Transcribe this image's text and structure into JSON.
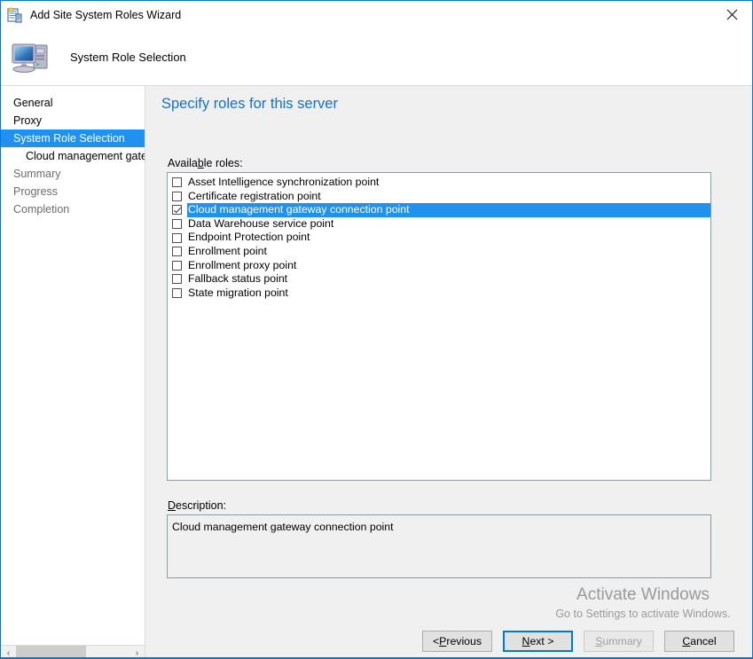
{
  "window": {
    "title": "Add Site System Roles Wizard",
    "icon": "wizard-document-icon",
    "close_label": "✕",
    "accent_color": "#0078d7"
  },
  "header": {
    "title": "System Role Selection",
    "icon": "computer-icon"
  },
  "sidebar": {
    "items": [
      {
        "label": "General",
        "state": "normal",
        "sub": false
      },
      {
        "label": "Proxy",
        "state": "normal",
        "sub": false
      },
      {
        "label": "System Role Selection",
        "state": "selected",
        "sub": false
      },
      {
        "label": "Cloud management gate",
        "state": "normal",
        "sub": true
      },
      {
        "label": "Summary",
        "state": "dim",
        "sub": false
      },
      {
        "label": "Progress",
        "state": "dim",
        "sub": false
      },
      {
        "label": "Completion",
        "state": "dim",
        "sub": false
      }
    ],
    "scrollbar": {
      "left_arrow": "‹",
      "right_arrow": "›"
    },
    "selected_color": "#2191ef"
  },
  "main": {
    "heading": "Specify roles for this server",
    "heading_color": "#1570cc",
    "roles_label_pre": "Availa",
    "roles_label_accel": "b",
    "roles_label_post": "le roles:",
    "roles": [
      {
        "label": "Asset Intelligence synchronization point",
        "checked": false,
        "selected": false
      },
      {
        "label": "Certificate registration point",
        "checked": false,
        "selected": false
      },
      {
        "label": "Cloud management gateway connection point",
        "checked": true,
        "selected": true
      },
      {
        "label": "Data Warehouse service point",
        "checked": false,
        "selected": false
      },
      {
        "label": "Endpoint Protection point",
        "checked": false,
        "selected": false
      },
      {
        "label": "Enrollment point",
        "checked": false,
        "selected": false
      },
      {
        "label": "Enrollment proxy point",
        "checked": false,
        "selected": false
      },
      {
        "label": "Fallback status point",
        "checked": false,
        "selected": false
      },
      {
        "label": "State migration point",
        "checked": false,
        "selected": false
      }
    ],
    "description_label_accel": "D",
    "description_label_post": "escription:",
    "description_text": "Cloud management gateway connection point"
  },
  "watermark": {
    "title": "Activate Windows",
    "subtitle": "Go to Settings to activate Windows."
  },
  "footer": {
    "previous": {
      "pre": "< ",
      "accel": "P",
      "post": "revious",
      "state": "normal"
    },
    "next": {
      "pre": "",
      "accel": "N",
      "post": "ext >",
      "state": "focused"
    },
    "summary": {
      "pre": "",
      "accel": "S",
      "post": "ummary",
      "state": "disabled"
    },
    "cancel": {
      "pre": "",
      "accel": "C",
      "post": "ancel",
      "state": "normal"
    }
  }
}
